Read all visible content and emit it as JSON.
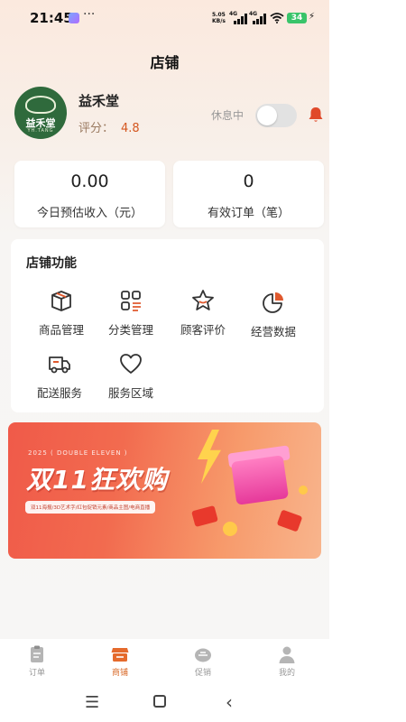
{
  "status_bar": {
    "time": "21:45",
    "more": "···",
    "net_speed_value": "5.05",
    "net_speed_unit": "KB/s",
    "net_type1": "4G",
    "net_type2": "4G",
    "battery": "34"
  },
  "header": {
    "title": "店铺"
  },
  "store": {
    "logo_text": "益禾堂",
    "logo_sub": "YH.TANG",
    "name": "益禾堂",
    "rating_label": "评分：",
    "rating_value": "4.8",
    "status_label": "休息中",
    "open": false
  },
  "stats": [
    {
      "value": "0.00",
      "label": "今日预估收入（元）"
    },
    {
      "value": "0",
      "label": "有效订单（笔）"
    }
  ],
  "functions": {
    "title": "店铺功能",
    "items": [
      {
        "label": "商品管理",
        "icon": "box-icon"
      },
      {
        "label": "分类管理",
        "icon": "category-icon"
      },
      {
        "label": "顾客评价",
        "icon": "star-icon"
      },
      {
        "label": "经营数据",
        "icon": "pie-chart-icon"
      },
      {
        "label": "配送服务",
        "icon": "truck-icon"
      },
      {
        "label": "服务区域",
        "icon": "heart-icon"
      }
    ]
  },
  "banner": {
    "subtitle": "2025 ( DOUBLE ELEVEN )",
    "title": "双11狂欢购",
    "tags": "双11海报/3D艺术字/红包促销元素/商品主图/电商直播"
  },
  "tab_bar": {
    "items": [
      {
        "label": "订单",
        "icon": "clipboard-icon",
        "active": false
      },
      {
        "label": "商铺",
        "icon": "shop-icon",
        "active": true
      },
      {
        "label": "促销",
        "icon": "promo-icon",
        "active": false
      },
      {
        "label": "我的",
        "icon": "person-icon",
        "active": false
      }
    ]
  },
  "colors": {
    "accent": "#d96c2c",
    "bell": "#e0492a",
    "logo_bg": "#2f6a3c",
    "banner": "#f05a49"
  }
}
